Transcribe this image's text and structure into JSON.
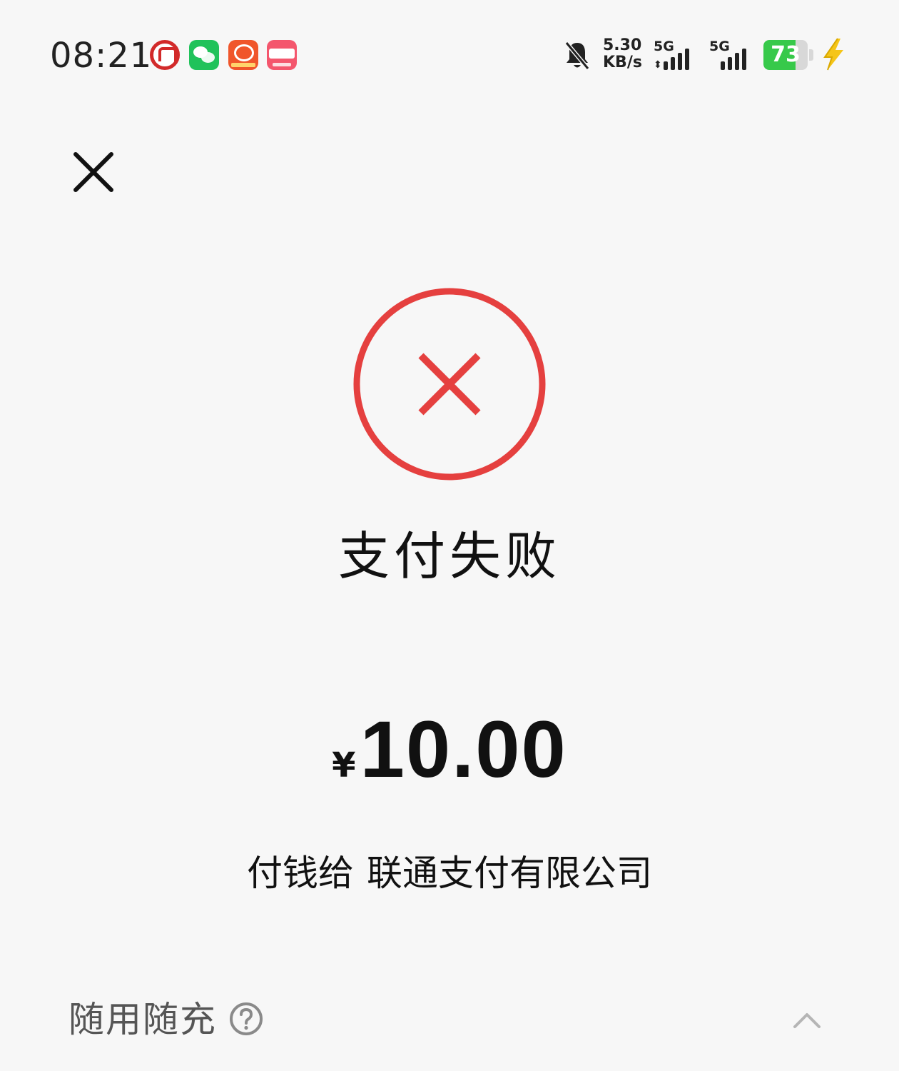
{
  "status_bar": {
    "time": "08:21",
    "net_speed_value": "5.30",
    "net_speed_unit": "KB/s",
    "sim1_label": "5G",
    "sim2_label": "5G",
    "battery_level": "73",
    "battery_fraction": 0.73,
    "icons": [
      "bank-app-icon",
      "wechat-icon",
      "orange-app-icon",
      "pink-app-icon",
      "bell-muted-icon",
      "signal-icon",
      "battery-icon",
      "bolt-icon"
    ]
  },
  "header": {
    "close_icon": "close-icon"
  },
  "result": {
    "status_icon": "fail-x-icon",
    "title": "支付失败",
    "currency_symbol": "¥",
    "amount": "10.00",
    "payee_prefix": "付钱给",
    "payee_name": "联通支付有限公司"
  },
  "section": {
    "label": "随用随充",
    "help_icon": "help-icon",
    "expand_icon": "chevron-up-icon"
  },
  "colors": {
    "background": "#f7f7f7",
    "fail_red": "#e5403f",
    "battery_green": "#37c94a",
    "wechat_green": "#20c25a",
    "charge_yellow": "#f5c518"
  }
}
